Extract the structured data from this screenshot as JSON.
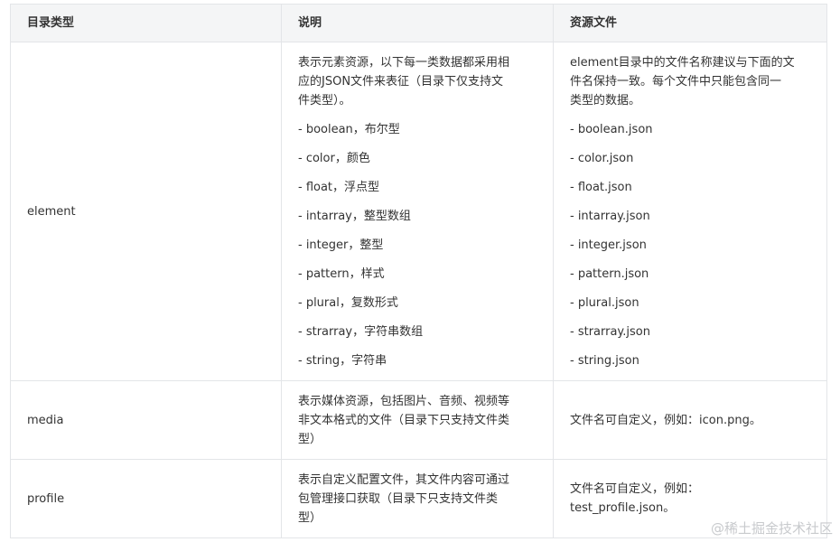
{
  "headers": [
    "目录类型",
    "说明",
    "资源文件"
  ],
  "rows": [
    {
      "type": "element",
      "desc_lines": [
        "表示元素资源，以下每一类数据都采用相",
        "应的JSON文件来表征（目录下仅支持文",
        "件类型）。"
      ],
      "desc_items": [
        "- boolean，布尔型",
        "- color，颜色",
        "- float，浮点型",
        "- intarray，整型数组",
        "- integer，整型",
        "- pattern，样式",
        "- plural，复数形式",
        "- strarray，字符串数组",
        "- string，字符串"
      ],
      "file_lines": [
        "element目录中的文件名称建议与下面的文",
        "件名保持一致。每个文件中只能包含同一",
        "类型的数据。"
      ],
      "file_items": [
        "- boolean.json",
        "- color.json",
        "- float.json",
        "- intarray.json",
        "- integer.json",
        "- pattern.json",
        "- plural.json",
        "- strarray.json",
        "- string.json"
      ]
    },
    {
      "type": "media",
      "desc_lines": [
        "表示媒体资源，包括图片、音频、视频等",
        "非文本格式的文件（目录下只支持文件类",
        "型）"
      ],
      "file_lines": [
        "文件名可自定义，例如：icon.png。"
      ]
    },
    {
      "type": "profile",
      "desc_lines": [
        "表示自定义配置文件，其文件内容可通过",
        "包管理接口获取（目录下只支持文件类",
        "型）"
      ],
      "file_lines": [
        "文件名可自定义，例如：",
        "test_profile.json。"
      ]
    }
  ],
  "watermark": "@稀土掘金技术社区"
}
